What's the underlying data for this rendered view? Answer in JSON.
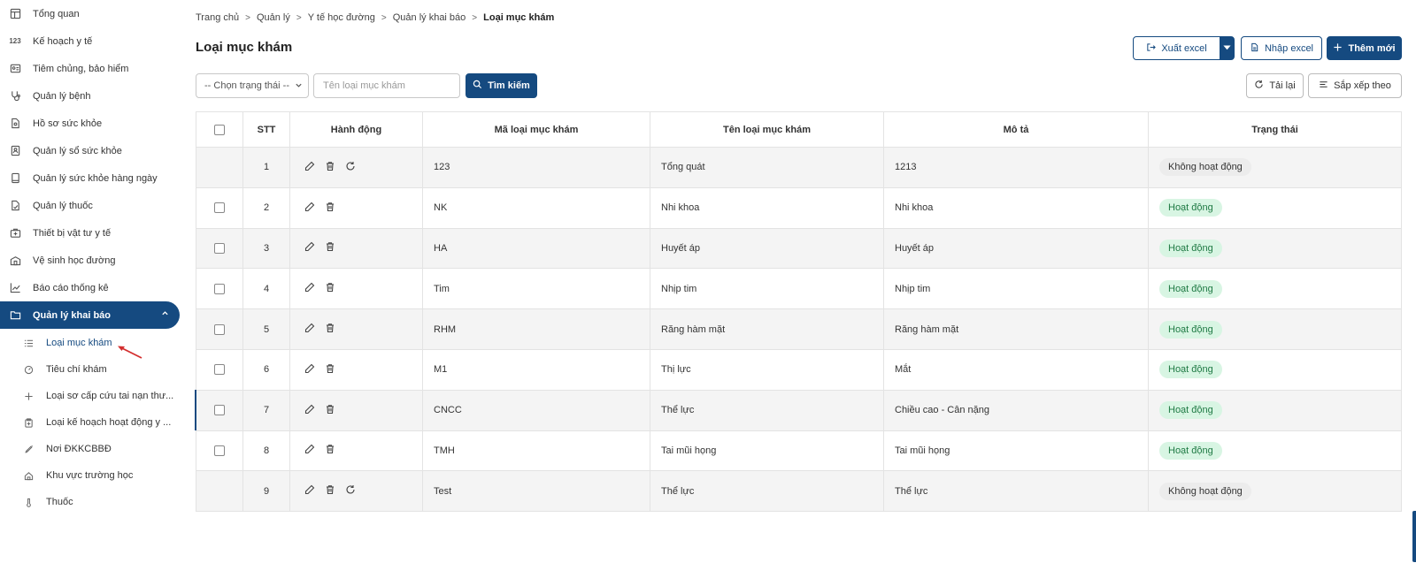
{
  "sidebar": {
    "items": [
      {
        "label": "Tổng quan",
        "icon": "dashboard-icon"
      },
      {
        "label": "Kế hoạch y tế",
        "icon": "numbers-icon"
      },
      {
        "label": "Tiêm chủng, bảo hiểm",
        "icon": "id-card-icon"
      },
      {
        "label": "Quản lý bệnh",
        "icon": "stethoscope-icon"
      },
      {
        "label": "Hồ sơ sức khỏe",
        "icon": "file-icon"
      },
      {
        "label": "Quản lý sổ sức khỏe",
        "icon": "contact-book-icon"
      },
      {
        "label": "Quản lý sức khỏe hàng ngày",
        "icon": "tablet-icon"
      },
      {
        "label": "Quản lý thuốc",
        "icon": "prescription-icon"
      },
      {
        "label": "Thiết bị vật tư y tế",
        "icon": "medkit-icon"
      },
      {
        "label": "Vệ sinh học đường",
        "icon": "school-icon"
      },
      {
        "label": "Báo cáo thống kê",
        "icon": "chart-line-icon"
      },
      {
        "label": "Quản lý khai báo",
        "icon": "folder-open-icon"
      }
    ],
    "sub_items": [
      {
        "label": "Loại mục khám",
        "icon": "list-icon"
      },
      {
        "label": "Tiêu chí khám",
        "icon": "gauge-icon"
      },
      {
        "label": "Loại sơ cấp cứu tai nạn thư...",
        "icon": "plus-icon"
      },
      {
        "label": "Loại kế hoạch hoạt động y ...",
        "icon": "clipboard-plus-icon"
      },
      {
        "label": "Nơi ĐKKCBBĐ",
        "icon": "syringe-icon"
      },
      {
        "label": "Khu vực trường học",
        "icon": "home-icon"
      },
      {
        "label": "Thuốc",
        "icon": "thermometer-icon"
      }
    ]
  },
  "breadcrumb": [
    "Trang chủ",
    "Quản lý",
    "Y tế học đường",
    "Quản lý khai báo",
    "Loại mục khám"
  ],
  "page_title": "Loại mục khám",
  "toolbar": {
    "export_label": "Xuất excel",
    "import_label": "Nhập excel",
    "add_label": "Thêm mới",
    "reload_label": "Tải lại",
    "sort_label": "Sắp xếp theo",
    "search_button_label": "Tìm kiếm"
  },
  "filters": {
    "status_select": "-- Chọn trạng thái --",
    "name_placeholder": "Tên loại mục khám"
  },
  "table": {
    "headers": [
      "STT",
      "Hành động",
      "Mã loại mục khám",
      "Tên loại mục khám",
      "Mô tả",
      "Trạng thái"
    ],
    "rows": [
      {
        "stt": "1",
        "code": "123",
        "name": "Tổng quát",
        "desc": "1213",
        "status": "Không hoạt động",
        "active": false
      },
      {
        "stt": "2",
        "code": "NK",
        "name": "Nhi khoa",
        "desc": "Nhi khoa",
        "status": "Hoạt động",
        "active": true
      },
      {
        "stt": "3",
        "code": "HA",
        "name": "Huyết áp",
        "desc": "Huyết áp",
        "status": "Hoạt động",
        "active": true
      },
      {
        "stt": "4",
        "code": "Tim",
        "name": "Nhịp tim",
        "desc": "Nhịp tim",
        "status": "Hoạt động",
        "active": true
      },
      {
        "stt": "5",
        "code": "RHM",
        "name": "Răng hàm mặt",
        "desc": "Răng hàm mặt",
        "status": "Hoạt động",
        "active": true
      },
      {
        "stt": "6",
        "code": "M1",
        "name": "Thị lực",
        "desc": "Mắt",
        "status": "Hoạt động",
        "active": true
      },
      {
        "stt": "7",
        "code": "CNCC",
        "name": "Thể lực",
        "desc": "Chiều cao - Cân nặng",
        "status": "Hoạt động",
        "active": true
      },
      {
        "stt": "8",
        "code": "TMH",
        "name": "Tai mũi họng",
        "desc": "Tai mũi họng",
        "status": "Hoạt động",
        "active": true
      },
      {
        "stt": "9",
        "code": "Test",
        "name": "Thể lực",
        "desc": "Thể lực",
        "status": "Không hoạt động",
        "active": false
      }
    ]
  },
  "colors": {
    "primary": "#154a80",
    "active_badge_bg": "#d8f5e3",
    "inactive_badge_bg": "#ececec",
    "annotation_arrow": "#d32f2f"
  }
}
